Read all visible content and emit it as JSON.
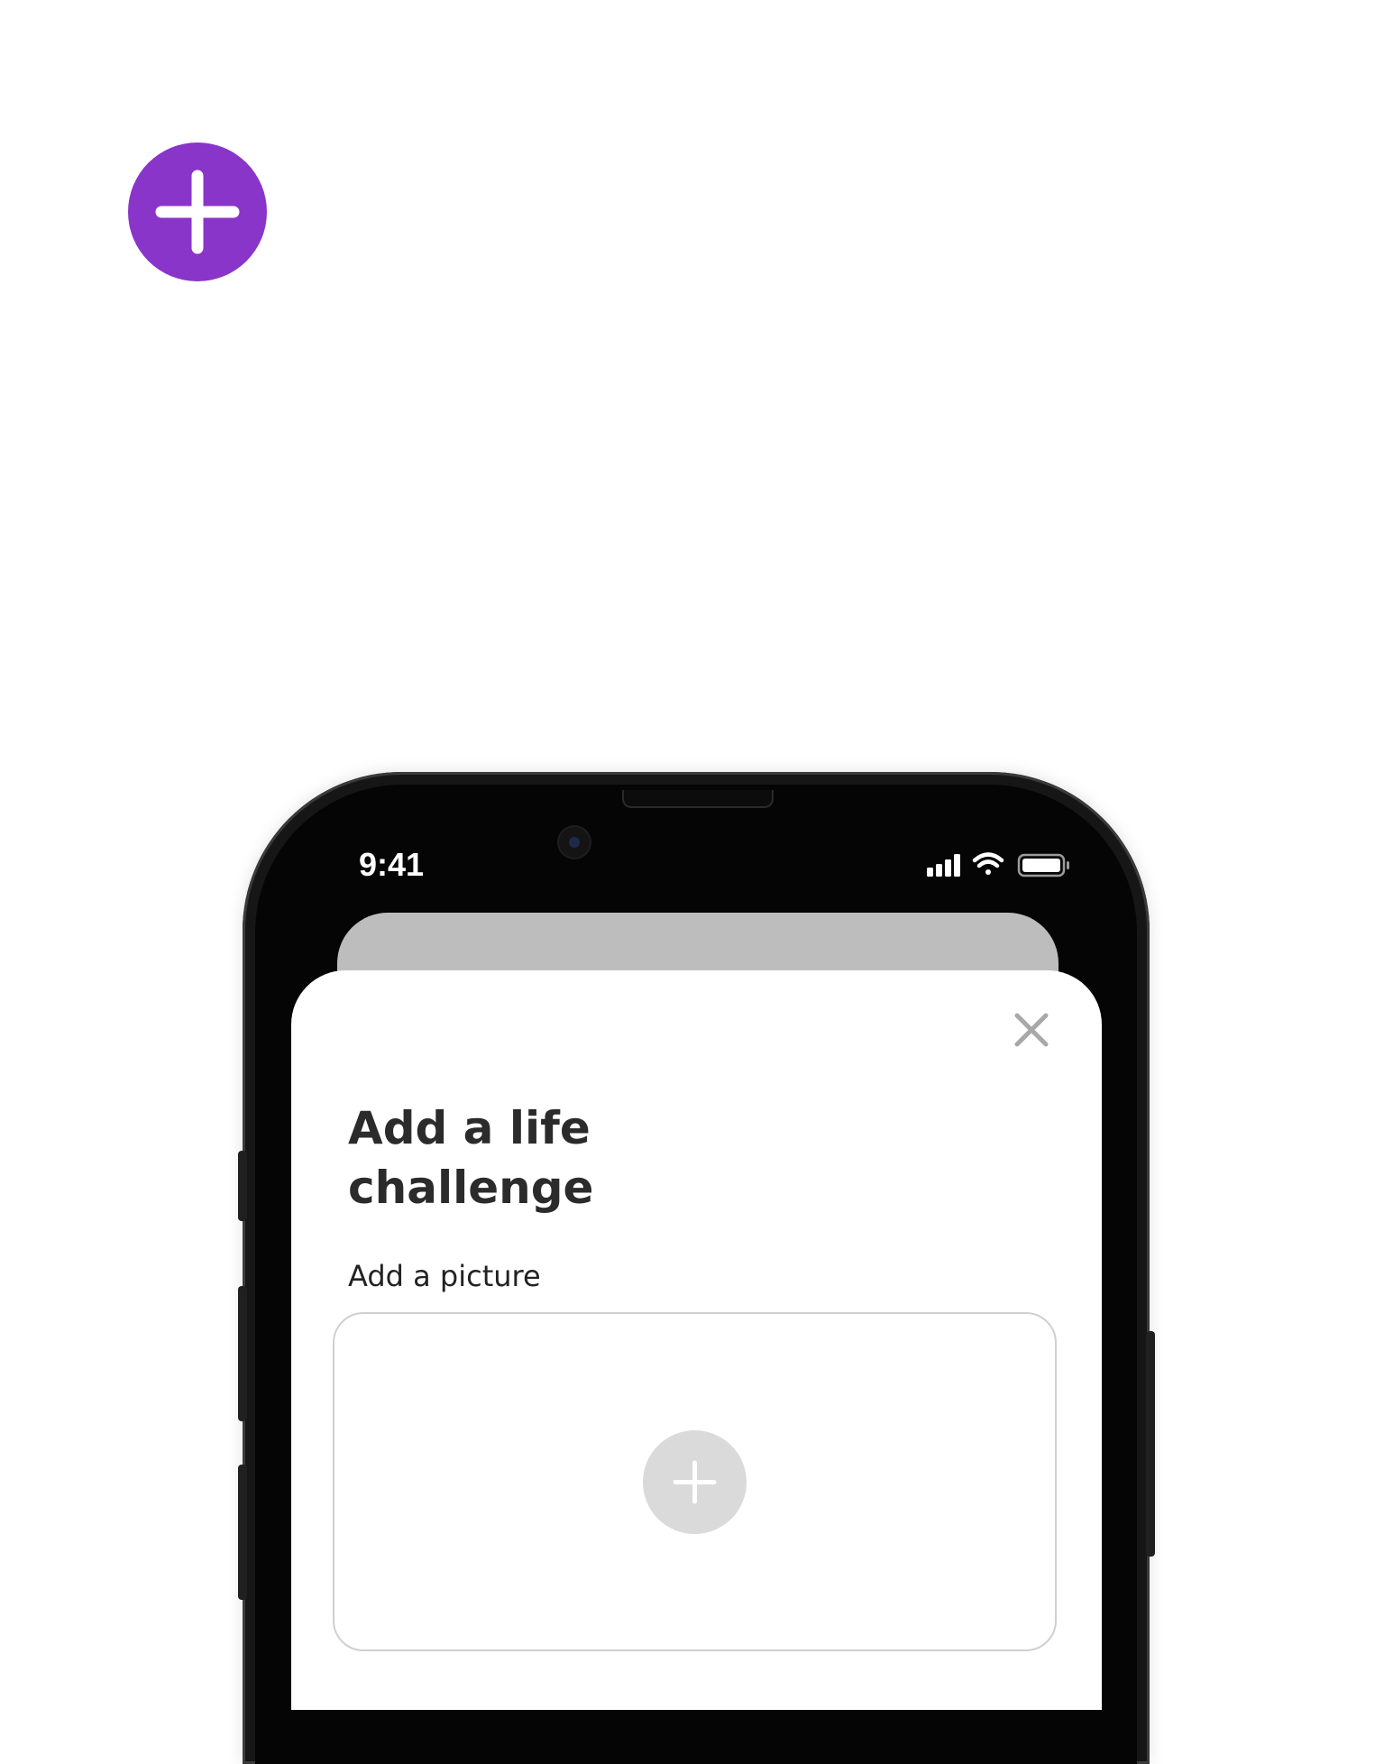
{
  "colors": {
    "accent": "#8A35C9",
    "sheet_background": "#FFFFFF",
    "placeholder_card": "#BDBDBD",
    "add_picture_circle": "#DADADA"
  },
  "fab": {
    "icon": "plus-icon"
  },
  "status_bar": {
    "time": "9:41",
    "icons": [
      "cellular-signal-icon",
      "wifi-icon",
      "battery-icon"
    ]
  },
  "sheet": {
    "close_icon": "close-icon",
    "title_line1": "Add a life",
    "title_line2": "challenge",
    "picture_label": "Add a picture",
    "picture_add_icon": "plus-icon"
  }
}
